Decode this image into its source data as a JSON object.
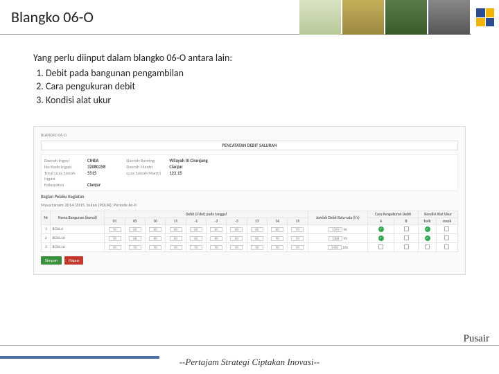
{
  "header": {
    "title": "Blangko 06-O"
  },
  "intro": {
    "lead": "Yang perlu diinput dalam blangko 06-O antara lain:",
    "items": [
      "Debit pada bangunan pengambilan",
      "Cara pengukuran debit",
      "Kondisi alat ukur"
    ]
  },
  "screenshot": {
    "breadcrumb": "BLANGKO 06-O",
    "panel_title": "PENCATATAN DEBIT SALURAN",
    "info_left": [
      {
        "label": "Daerah Irigasi",
        "value": "CIHEA"
      },
      {
        "label": "No Kode Irigasi",
        "value": "32080258"
      },
      {
        "label": "Total Luas Sawah Irigasi",
        "value": "5515"
      },
      {
        "label": "Kabupaten",
        "value": "Cianjur"
      }
    ],
    "info_right": [
      {
        "label": "Daerah Ranting",
        "value": "Wilayah III Ciranjang"
      },
      {
        "label": "Daerah Mantri",
        "value": "Cianjur"
      },
      {
        "label": "Luas Sawah Mantri",
        "value": "122.15"
      }
    ],
    "section_sub": "Bagian Pelaku Kegiatan",
    "period": "Masa tanam 2014/2015, bulan (POUR), Periode ke-II",
    "table": {
      "group_header": "Debit (l/det) pada tanggal",
      "header1": [
        "Nr",
        "Nama Bangunan (kursal)",
        "01",
        "05",
        "10",
        "11",
        "-1",
        "-2",
        "-3",
        "13",
        "14",
        "15",
        "Jumlah Debit Rata-rata (l/s)",
        "Cara Pengukuran Debit",
        "Kondisi Alat Ukur",
        ""
      ],
      "sub_header_right": [
        "A",
        "B",
        "baik",
        "rusak"
      ],
      "rows": [
        {
          "nr": "1",
          "name": "BCS6.6",
          "vals": [
            "90",
            "80",
            "80",
            "80",
            "80",
            "85",
            "80",
            "80",
            "80",
            "90"
          ],
          "sum": "1345",
          "avg": "96",
          "a": "✓",
          "b": "",
          "baik": "✓",
          "rusak": ""
        },
        {
          "nr": "2",
          "name": "BCS6.10",
          "vals": [
            "90",
            "88",
            "80",
            "80",
            "80",
            "80",
            "80",
            "80",
            "90",
            "90"
          ],
          "sum": "1388",
          "avg": "99",
          "a": "✓",
          "b": "",
          "baik": "✓",
          "rusak": ""
        },
        {
          "nr": "3",
          "name": "BCS6.16",
          "vals": [
            "90",
            "90",
            "90",
            "90",
            "90",
            "90",
            "90",
            "90",
            "90",
            "90"
          ],
          "sum": "1400",
          "avg": "100",
          "a": "",
          "b": "",
          "baik": "",
          "rusak": ""
        }
      ]
    },
    "buttons": {
      "save": "Simpan",
      "delete": "Hapus"
    }
  },
  "footer": {
    "right": "Pusair",
    "center": "--Pertajam Strategi Ciptakan Inovasi--"
  }
}
